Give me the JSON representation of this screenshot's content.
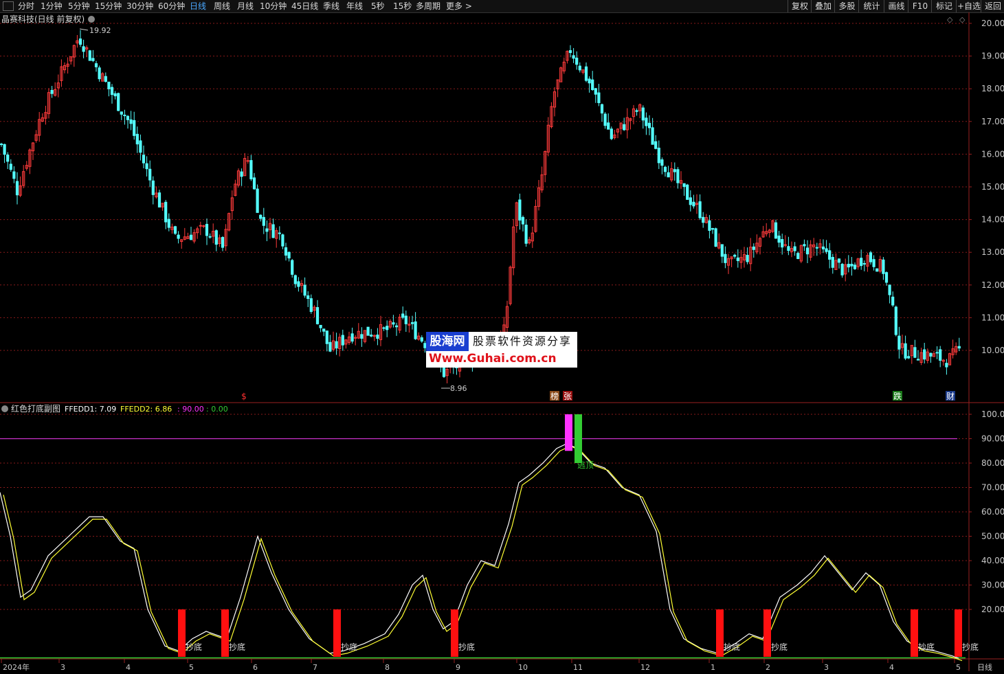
{
  "toolbar": {
    "periods": [
      "分时",
      "1分钟",
      "5分钟",
      "15分钟",
      "30分钟",
      "60分钟",
      "日线",
      "周线",
      "月线",
      "10分钟",
      "45日线",
      "季线",
      "年线",
      "5秒",
      "15秒",
      "多周期",
      "更多 >"
    ],
    "active": "日线",
    "right_buttons": [
      "复权",
      "叠加",
      "多股",
      "统计",
      "画线",
      "F10",
      "标记",
      "+自选",
      "返回"
    ]
  },
  "main_chart": {
    "title": "晶赛科技(日线 前复权)",
    "high_label": "19.92",
    "low_label": "8.96",
    "price_ticks": [
      "20.00",
      "19.00",
      "18.00",
      "17.00",
      "16.00",
      "15.00",
      "14.00",
      "13.00",
      "12.00",
      "11.00",
      "10.00"
    ],
    "markers": [
      {
        "text": "$",
        "color": "#ff3030",
        "boxed": false
      },
      {
        "text": "榜",
        "color": "#ffffff",
        "bg": "#8a4b1a",
        "boxed": true
      },
      {
        "text": "张",
        "color": "#ffffff",
        "bg": "#9a1010",
        "boxed": true
      },
      {
        "text": "跌",
        "color": "#ffffff",
        "bg": "#1a7a1a",
        "boxed": true
      },
      {
        "text": "财",
        "color": "#ffffff",
        "bg": "#1a3a8a",
        "boxed": true
      }
    ]
  },
  "indicator": {
    "name": "红色打底副图",
    "ffedd1_label": "FFEDD1:",
    "ffedd1_value": "7.09",
    "ffedd2_label": "FFEDD2:",
    "ffedd2_value": "6.86",
    "level_hi": ": 90.00",
    "level_lo": ": 0.00",
    "ticks": [
      "100.0",
      "90.00",
      "80.00",
      "70.00",
      "60.00",
      "50.00",
      "40.00",
      "30.00",
      "20.00"
    ],
    "bottom_label": "抄底",
    "top_label": "逃顶"
  },
  "date_axis": {
    "labels": [
      "2024年",
      "3",
      "4",
      "5",
      "6",
      "7",
      "8",
      "9",
      "10",
      "11",
      "12",
      "1",
      "2",
      "3",
      "4",
      "5"
    ],
    "period": "日线"
  },
  "watermark": {
    "line1": "股海网",
    "line2": "股票软件资源分享",
    "line3": "Www.Guhai.com.cn"
  },
  "colors": {
    "up": "#ff3b3b",
    "down": "#54ffff",
    "line1": "#ffffff",
    "line2": "#ffff33",
    "signal_red": "#ff1010",
    "signal_magenta": "#ff33ff",
    "signal_green": "#33cc33",
    "grid": "#8a1a1a"
  }
}
